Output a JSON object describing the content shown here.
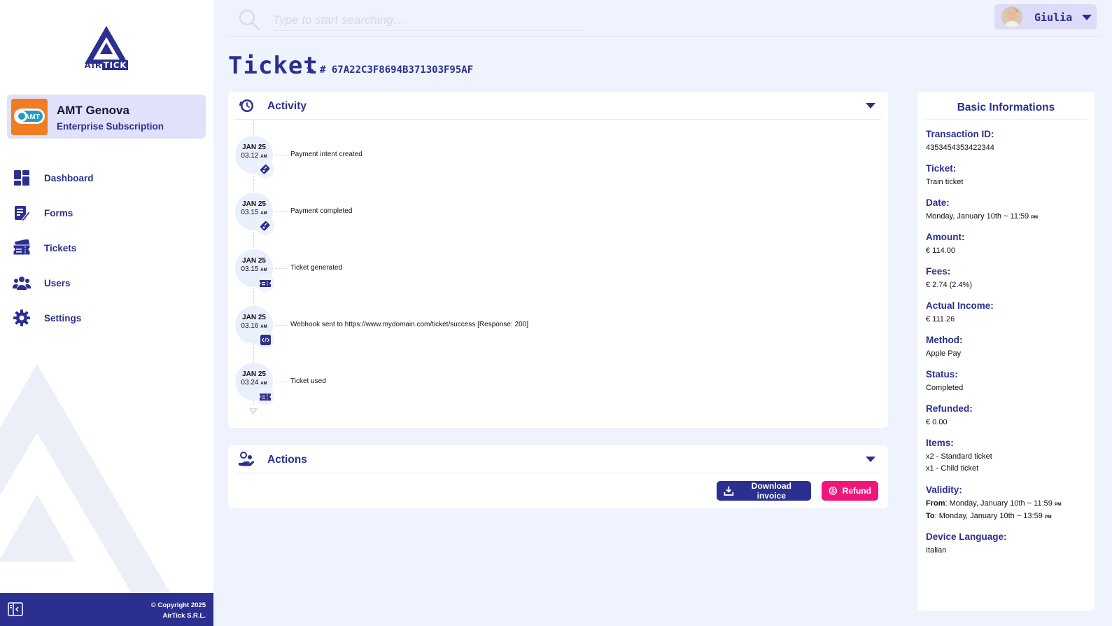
{
  "brand": {
    "logo_text_left": "AIR",
    "logo_text_right": "TICK",
    "accent": "#2b2f8f",
    "danger": "#f0157a"
  },
  "org": {
    "name": "AMT Genova",
    "subscription": "Enterprise Subscription",
    "icon_label": "AMT"
  },
  "sidebar": {
    "items": [
      {
        "label": "Dashboard",
        "icon": "dashboard-icon"
      },
      {
        "label": "Forms",
        "icon": "forms-icon"
      },
      {
        "label": "Tickets",
        "icon": "tickets-icon"
      },
      {
        "label": "Users",
        "icon": "users-icon"
      },
      {
        "label": "Settings",
        "icon": "settings-icon"
      }
    ]
  },
  "footer": {
    "copyright": "© Copyright 2025",
    "company": "AirTick S.R.L."
  },
  "search": {
    "placeholder": "Type to start searching…"
  },
  "user": {
    "name": "Giulia"
  },
  "page": {
    "title": "Ticket",
    "separator": ">",
    "ticket_hash": "# 67A22C3F8694B371303F95AF"
  },
  "activity": {
    "title": "Activity",
    "events": [
      {
        "date": "JAN 25",
        "time": "03.12",
        "ampm": "AM",
        "text": "Payment intent created",
        "icon": "payment-icon"
      },
      {
        "date": "JAN 25",
        "time": "03.15",
        "ampm": "AM",
        "text": "Payment completed",
        "icon": "payment-icon"
      },
      {
        "date": "JAN 25",
        "time": "03.15",
        "ampm": "AM",
        "text": "Ticket generated",
        "icon": "ticket-icon"
      },
      {
        "date": "JAN 25",
        "time": "03.16",
        "ampm": "AM",
        "text": "Webhook sent to https://www.mydomain.com/ticket/success [Response: 200]",
        "icon": "code-icon"
      },
      {
        "date": "JAN 25",
        "time": "03.24",
        "ampm": "AM",
        "text": "Ticket used",
        "icon": "ticket-icon"
      }
    ]
  },
  "actions": {
    "title": "Actions",
    "download_label": "Download invoice",
    "refund_label": "Refund"
  },
  "info": {
    "title": "Basic Informations",
    "transaction_id": {
      "label": "Transaction ID:",
      "value": "4353454353422344"
    },
    "ticket": {
      "label": "Ticket:",
      "value": "Train ticket"
    },
    "date": {
      "label": "Date:",
      "value": "Monday, January 10th ~ 11:59",
      "ampm": "PM"
    },
    "amount": {
      "label": "Amount:",
      "value": "€ 114.00"
    },
    "fees": {
      "label": "Fees:",
      "value": "€ 2.74 (2.4%)"
    },
    "income": {
      "label": "Actual Income:",
      "value": "€ 111.26"
    },
    "method": {
      "label": "Method:",
      "value": "Apple Pay"
    },
    "status": {
      "label": "Status:",
      "value": "Completed"
    },
    "refunded": {
      "label": "Refunded:",
      "value": "€ 0.00"
    },
    "items": {
      "label": "Items:",
      "line1": "x2 - Standard ticket",
      "line2": "x1 - Child ticket"
    },
    "validity": {
      "label": "Validity:",
      "from_label": "From",
      "from_value": ": Monday, January 10th ~ 11:59",
      "from_ampm": "PM",
      "to_label": "To",
      "to_value": ": Monday, January 10th ~ 13:59",
      "to_ampm": "PM"
    },
    "language": {
      "label": "Device Language:",
      "value": "Italian"
    }
  }
}
